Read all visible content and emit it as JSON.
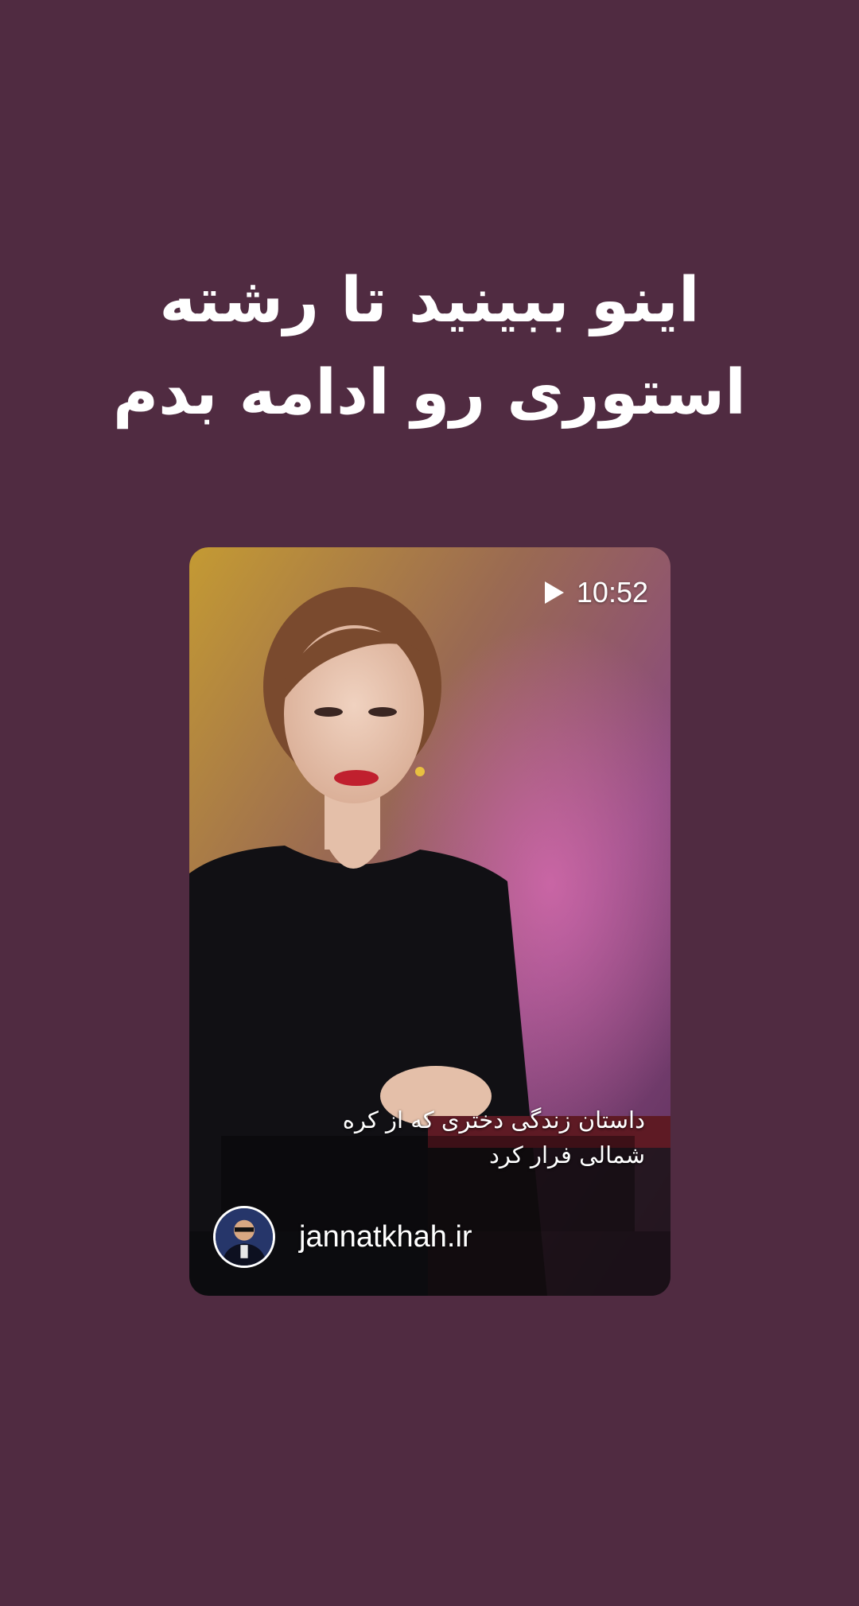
{
  "colors": {
    "background": "#502b41",
    "text": "#ffffff"
  },
  "story": {
    "headline_lines": [
      "اینو ببینید تا رشته",
      "استوری رو ادامه بدم"
    ],
    "attached_video": {
      "duration": "10:52",
      "play_icon": "play-icon",
      "caption_lines": [
        "داستان زندگی دختری که از کره",
        "شمالی فرار کرد"
      ],
      "source_name": "jannatkhah.ir",
      "source_avatar": "avatar"
    }
  }
}
